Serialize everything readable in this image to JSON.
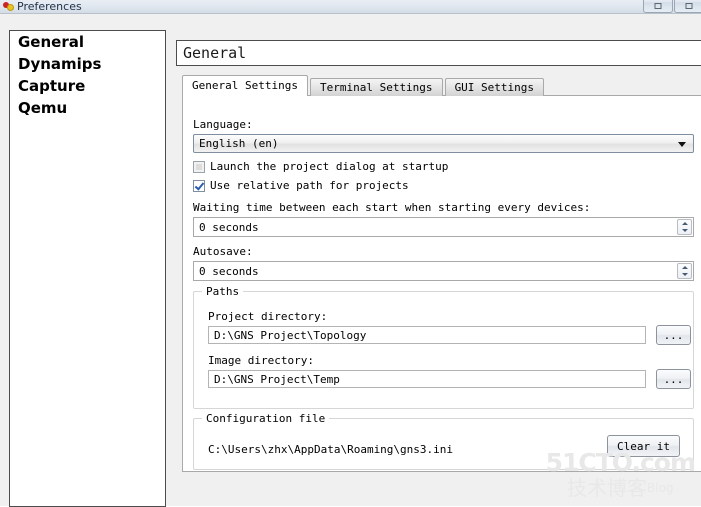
{
  "window": {
    "title": "Preferences",
    "icon": "gns3-app-icon",
    "buttons": [
      {
        "name": "maximize-button",
        "glyph": "maximize-icon"
      },
      {
        "name": "close-button",
        "glyph": "close-icon"
      }
    ]
  },
  "sidebar": {
    "items": [
      {
        "label": "General"
      },
      {
        "label": "Dynamips"
      },
      {
        "label": "Capture"
      },
      {
        "label": "Qemu"
      }
    ]
  },
  "section": {
    "header": "General"
  },
  "tabs": [
    {
      "label": "General Settings",
      "active": true
    },
    {
      "label": "Terminal Settings",
      "active": false
    },
    {
      "label": "GUI Settings",
      "active": false
    }
  ],
  "form": {
    "language_label": "Language:",
    "language_value": "English (en)",
    "launch_dialog_label": "Launch the project dialog at startup",
    "launch_dialog_checked": false,
    "relative_path_label": "Use relative path for projects",
    "relative_path_checked": true,
    "waiting_time_label": "Waiting time between each start when starting every devices:",
    "waiting_time_value": "0 seconds",
    "autosave_label": "Autosave:",
    "autosave_value": "0 seconds",
    "paths_group_title": "Paths",
    "project_dir_label": "Project directory:",
    "project_dir_value": "D:\\GNS Project\\Topology",
    "project_dir_browse": "...",
    "image_dir_label": "Image directory:",
    "image_dir_value": "D:\\GNS Project\\Temp",
    "image_dir_browse": "...",
    "config_group_title": "Configuration file",
    "config_file_path": "C:\\Users\\zhx\\AppData\\Roaming\\gns3.ini",
    "clear_button": "Clear it"
  },
  "watermark": {
    "line1": "51CTO.com",
    "line2": "技术博客",
    "line2_suffix": "Blog"
  },
  "colors": {
    "window_bg": "#f0f0f0",
    "panel_bg": "#ffffff",
    "border": "#a9a9a9",
    "check_accent": "#2a5db0",
    "title_text": "#21324a"
  }
}
